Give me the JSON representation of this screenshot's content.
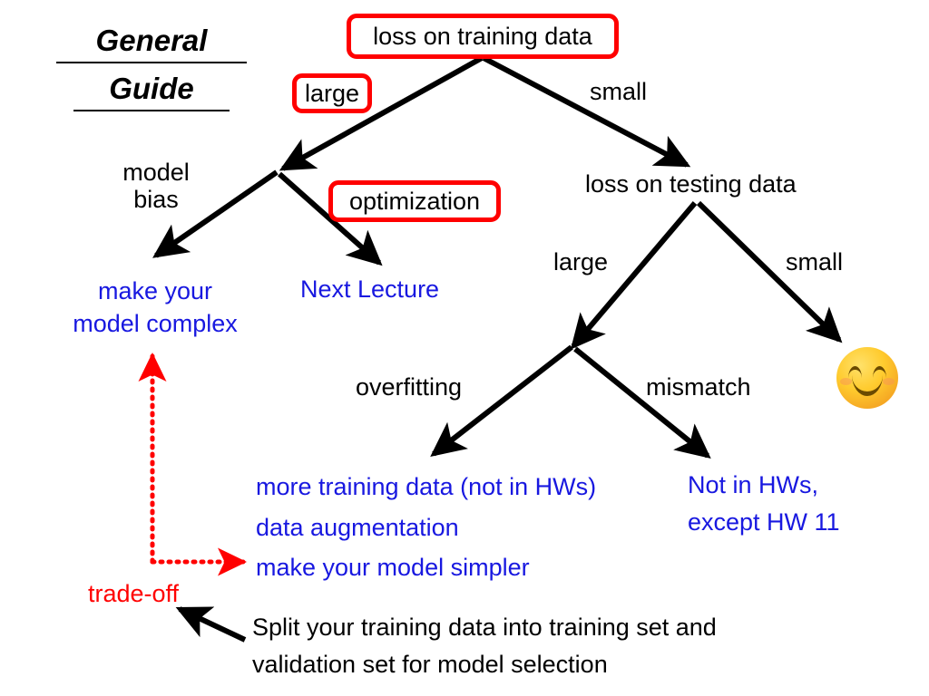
{
  "title": {
    "line1": "General",
    "line2": "Guide"
  },
  "colors": {
    "accent_red": "#ff0000",
    "link_blue": "#1818e0",
    "text_black": "#000000",
    "background": "#ffffff"
  },
  "nodes": {
    "loss_on_training_data": "loss on training data",
    "loss_on_testing_data": "loss on testing data",
    "optimization": "optimization",
    "model_bias": "model\nbias",
    "overfitting": "overfitting",
    "mismatch": "mismatch"
  },
  "edge_labels": {
    "train_large": "large",
    "train_small": "small",
    "test_large": "large",
    "test_small": "small"
  },
  "actions": {
    "make_model_complex": "make your\nmodel complex",
    "next_lecture": "Next Lecture",
    "overfitting_fixes": "more training data (not in HWs)\ndata augmentation\nmake your model simpler",
    "mismatch_note": "Not in HWs,\nexcept HW 11",
    "trade_off": "trade-off",
    "split_note": "Split your training data into training set and\nvalidation set for model selection"
  },
  "icons": {
    "happy_face": "smiling-face-with-smiling-eyes"
  }
}
